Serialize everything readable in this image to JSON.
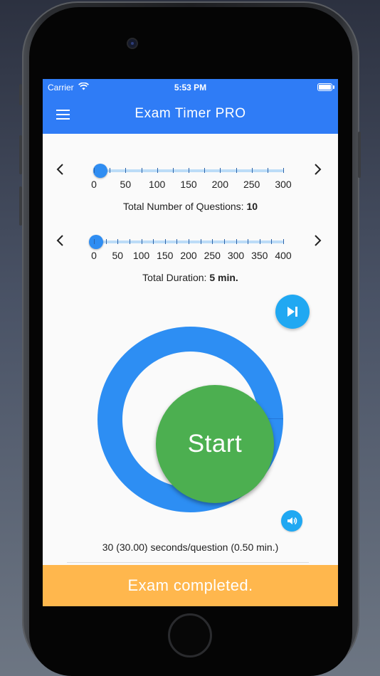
{
  "status_bar": {
    "carrier": "Carrier",
    "time": "5:53 PM"
  },
  "app_bar": {
    "title": "Exam Timer PRO"
  },
  "questions_slider": {
    "tick_labels": [
      "0",
      "50",
      "100",
      "150",
      "200",
      "250",
      "300"
    ],
    "min": 0,
    "max": 300,
    "value": 10,
    "caption_label": "Total Number of Questions:",
    "caption_value": "10"
  },
  "duration_slider": {
    "tick_labels": [
      "0",
      "50",
      "100",
      "150",
      "200",
      "250",
      "300",
      "350",
      "400"
    ],
    "min": 0,
    "max": 400,
    "value": 5,
    "caption_label": "Total Duration:",
    "caption_value": "5 min."
  },
  "timer": {
    "start_label": "Start",
    "progress": 0.0
  },
  "per_question_text": "30 (30.00) seconds/question (0.50 min.)",
  "banner_text": "Exam completed.",
  "colors": {
    "app_bar": "#2f7cf6",
    "ring": "#2d8ef3",
    "start": "#4caf50",
    "accent": "#20a8f2",
    "banner": "#ffb74d"
  },
  "icons": {
    "menu": "hamburger-menu-icon",
    "prev": "chevron-left-icon",
    "next": "chevron-right-icon",
    "skip": "skip-next-icon",
    "volume": "volume-icon",
    "wifi": "wifi-icon",
    "battery": "battery-icon"
  }
}
